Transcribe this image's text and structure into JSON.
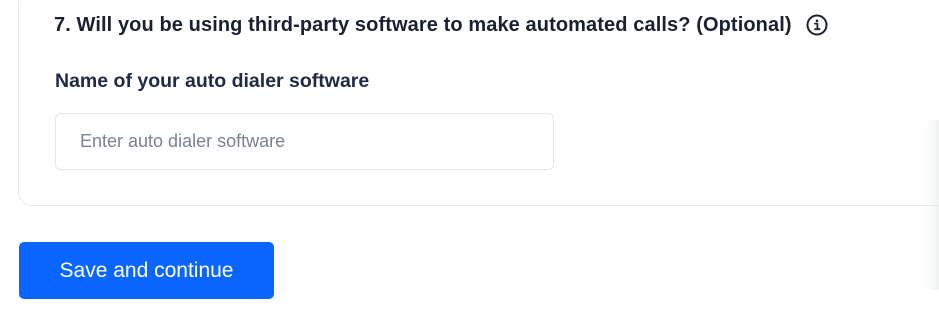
{
  "question": {
    "text": "7. Will you be using third-party software to make automated calls? (Optional)",
    "info_icon": "info-circle-icon"
  },
  "field": {
    "label": "Name of your auto dialer software",
    "placeholder": "Enter auto dialer software",
    "value": ""
  },
  "actions": {
    "save_label": "Save and continue"
  },
  "colors": {
    "primary": "#0a66ff",
    "heading": "#1b2030",
    "border": "#e3e6eb"
  }
}
